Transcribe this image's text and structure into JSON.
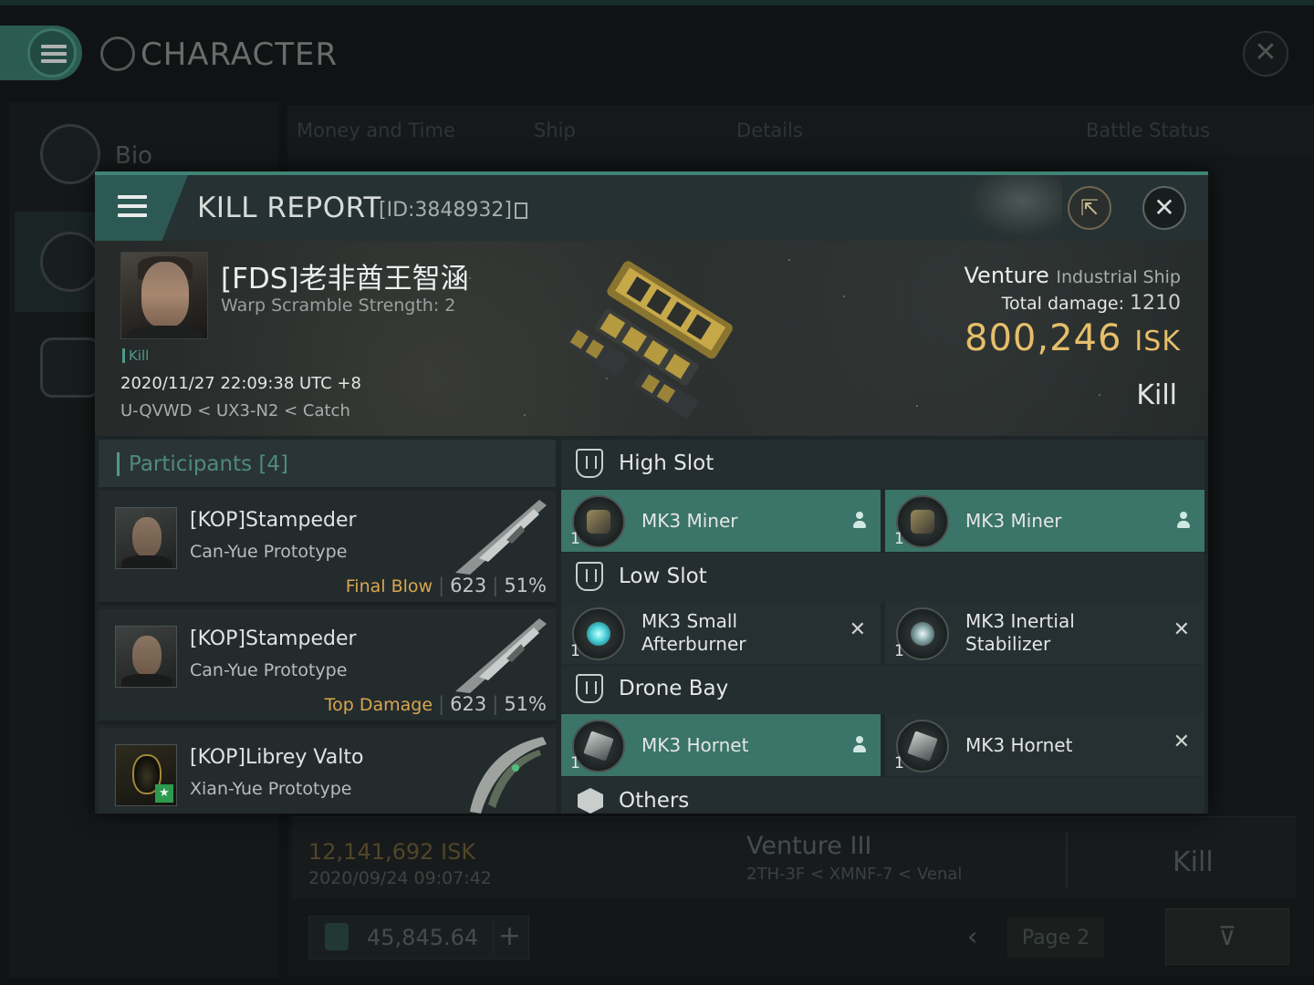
{
  "background": {
    "title": "CHARACTER",
    "sidebar": {
      "bio_label": "Bio"
    },
    "tabs": [
      {
        "label": "Money and Time"
      },
      {
        "label": "Ship"
      },
      {
        "label": "Details"
      },
      {
        "label": "Battle Status"
      }
    ],
    "last_row": {
      "isk": "12,141,692  ISK",
      "date": "2020/09/24  09:07:42",
      "ship": "Venture III",
      "location": "2TH-3F < XMNF-7 < Venal",
      "result": "Kill"
    },
    "wallet_value": "45,845.64",
    "wallet_plus": "+",
    "page_label": "Page 2",
    "prev_glyph": "‹",
    "filter_glyph": "⊽"
  },
  "modal": {
    "title": "KILL REPORT",
    "id_text": "[ID:3848932]",
    "victim": {
      "name": "[FDS]老非酋王智涵",
      "warp": "Warp Scramble Strength: 2",
      "kill_tag": "Kill",
      "timestamp": "2020/11/27 22:09:38 UTC +8",
      "location": "U-QVWD < UX3-N2 < Catch",
      "ship_name": "Venture",
      "ship_class": "Industrial Ship",
      "total_damage_label": "Total damage:",
      "total_damage": "1210",
      "isk_value": "800,246",
      "isk_unit": "ISK",
      "result": "Kill"
    },
    "participants": {
      "title": "Participants [4]",
      "items": [
        {
          "name": "[KOP]Stampeder",
          "ship": "Can-Yue Prototype",
          "tag": "Final Blow",
          "damage": "623",
          "percent": "51%"
        },
        {
          "name": "[KOP]Stampeder",
          "ship": "Can-Yue Prototype",
          "tag": "Top Damage",
          "damage": "623",
          "percent": "51%"
        },
        {
          "name": "[KOP]Librey Valto",
          "ship": "Xian-Yue Prototype",
          "tag": "",
          "damage": "",
          "percent": ""
        }
      ]
    },
    "fitting": {
      "high_slot": {
        "title": "High Slot",
        "modules": [
          {
            "qty": "1",
            "name": "MK3 Miner",
            "status": "dropped"
          },
          {
            "qty": "1",
            "name": "MK3 Miner",
            "status": "dropped"
          }
        ]
      },
      "low_slot": {
        "title": "Low Slot",
        "modules": [
          {
            "qty": "1",
            "name_line1": "MK3 Small",
            "name_line2": "Afterburner",
            "status": "destroyed"
          },
          {
            "qty": "1",
            "name_line1": "MK3 Inertial",
            "name_line2": "Stabilizer",
            "status": "destroyed"
          }
        ]
      },
      "drone_bay": {
        "title": "Drone Bay",
        "modules": [
          {
            "qty": "1",
            "name": "MK3  Hornet",
            "status": "dropped"
          },
          {
            "qty": "1",
            "name": "MK3  Hornet",
            "status": "destroyed"
          }
        ]
      },
      "others": {
        "title": "Others"
      }
    },
    "destroyed_glyph": "✕",
    "close_glyph": "✕",
    "share_glyph": "⇱"
  },
  "colors": {
    "accent": "#4f9a88",
    "dropped_bg": "#3b7468",
    "isk_gold": "#e6be6a",
    "tag_orange": "#d8a750"
  }
}
